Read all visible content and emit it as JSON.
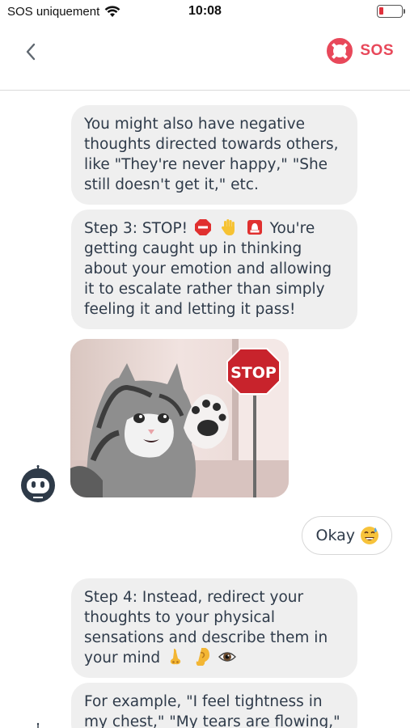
{
  "status_bar": {
    "carrier": "SOS uniquement",
    "time": "10:08"
  },
  "nav": {
    "sos_label": "SOS"
  },
  "colors": {
    "accent": "#e8485a",
    "bubble_bg": "#efefef",
    "text": "#2f3b4a",
    "avatar": "#2e3a48"
  },
  "messages": {
    "m1": "You might also have negative thoughts directed towards others, like \"They're never happy,\" \"She still doesn't get it,\" etc.",
    "m2_prefix": "Step 3: STOP!",
    "m2_suffix": "You're getting caught up in thinking about your emotion and allowing it to escalate rather than simply feeling it and letting it pass!",
    "m2_icons": [
      "stop-sign-icon",
      "raised-hand-icon",
      "siren-icon"
    ],
    "gif_sign": "STOP",
    "user_reply": "Okay",
    "m4": "Step 4: Instead, redirect your thoughts to your physical sensations and describe them in your mind",
    "m4_icons": [
      "nose-icon",
      "ear-icon",
      "eye-icon"
    ],
    "m5": "For example, \"I feel tightness in my chest,\" \"My tears are flowing,\""
  }
}
